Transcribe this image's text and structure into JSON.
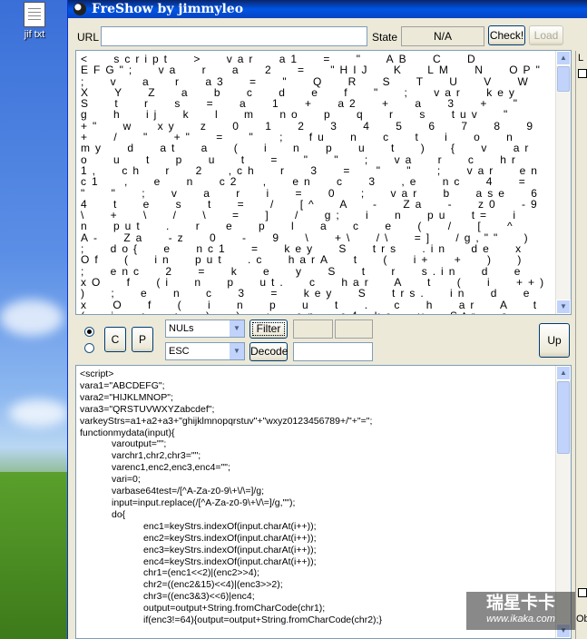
{
  "desktop": {
    "icon_label": "jif txt"
  },
  "window": {
    "title": "FreShow by jimmyleo"
  },
  "urlbar": {
    "url_label": "URL",
    "url_value": "",
    "state_label": "State",
    "state_value": "N/A",
    "check_label": "Check!",
    "load_label": "Load"
  },
  "encoded_text": "< script > var a1 = \" AB C D EFG\"; va r a 2 = \"HIJ K LM N OP\" ; v a r a3 = \" Q R S T U V W X Y Z a b c d e f \" ; var key S t r s = a 1 + a2 + a 3 + \" g h ij k l m no p q r s tuv \" +\" w xy z 0 1 2 3 4 5 6 7 8 9 + / \" +\" = \" ; fu n c t i o n my d at a ( i n p u t ) { v ar o u t p u t = \" \" ; va r c hr 1, ch r 2 ,ch r 3 = \" \" ; var en c1 , e n c2 , en c 3 ,e nc 4 = \" \" ; v a r i = 0 ; var b ase 6 4 t e s t = / [^ A - Za - z0 -9 \\ + \\ / \\ = ] / g; i n pu t= i n put . r e p l a c e ( / [ ^ A- Za -z 0 - 9 \\ +\\ /\\ =] /g,\"\" ) ; do{ e nc1 = key S trs .in de x Of ( in put .c harA t ( i+ + ) ) ; enc 2 = k e y S t r s.in d e xO f (i n p ut. c har A t ( i ++) ) ; e n c 3 = key S trs. in d e x O f ( i n p u t . c h ar A t ( i + + ) ) ; en c4=ke y Str s . ind exOf ( in p u t. char A t( i + + ) ) ; c hr 1 = ( en c 1 << 2 ) |(en c 2 > > 4 ) ; c hr2 = ( ( e nc 2 &1 5 ) < <4) |(en c 3",
  "controls": {
    "c_label": "C",
    "p_label": "P",
    "select1_value": "NULs",
    "select2_value": "ESC",
    "filter_label": "Filter",
    "decode_label": "Decode",
    "up_label": "Up"
  },
  "decoded_lines": [
    "<script>",
    "vara1=\"ABCDEFG\";",
    "vara2=\"HIJKLMNOP\";",
    "vara3=\"QRSTUVWXYZabcdef\";",
    "varkeyStrs=a1+a2+a3+\"ghijklmnopqrstuv\"+\"wxyz0123456789+/\"+\"=\";",
    "functionmydata(input){",
    "            varoutput=\"\";",
    "            varchr1,chr2,chr3=\"\";",
    "            varenc1,enc2,enc3,enc4=\"\";",
    "            vari=0;",
    "            varbase64test=/[^A-Za-z0-9\\+\\/\\=]/g;",
    "            input=input.replace(/[^A-Za-z0-9\\+\\/\\=]/g,\"\");",
    "            do{",
    "                        enc1=keyStrs.indexOf(input.charAt(i++));",
    "                        enc2=keyStrs.indexOf(input.charAt(i++));",
    "                        enc3=keyStrs.indexOf(input.charAt(i++));",
    "                        enc4=keyStrs.indexOf(input.charAt(i++));",
    "                        chr1=(enc1<<2)|(enc2>>4);",
    "                        chr2=((enc2&15)<<4)|(enc3>>2);",
    "                        chr3=((enc3&3)<<6)|enc4;",
    "                        output=output+String.fromCharCode(chr1);",
    "                        if(enc3!=64){output=output+String.fromCharCode(chr2);}"
  ],
  "side_panel": {
    "top_label": "L",
    "bottom_label": "Ob"
  },
  "watermark": {
    "line1": "瑞星卡卡",
    "line2": "www.ikaka.com"
  }
}
